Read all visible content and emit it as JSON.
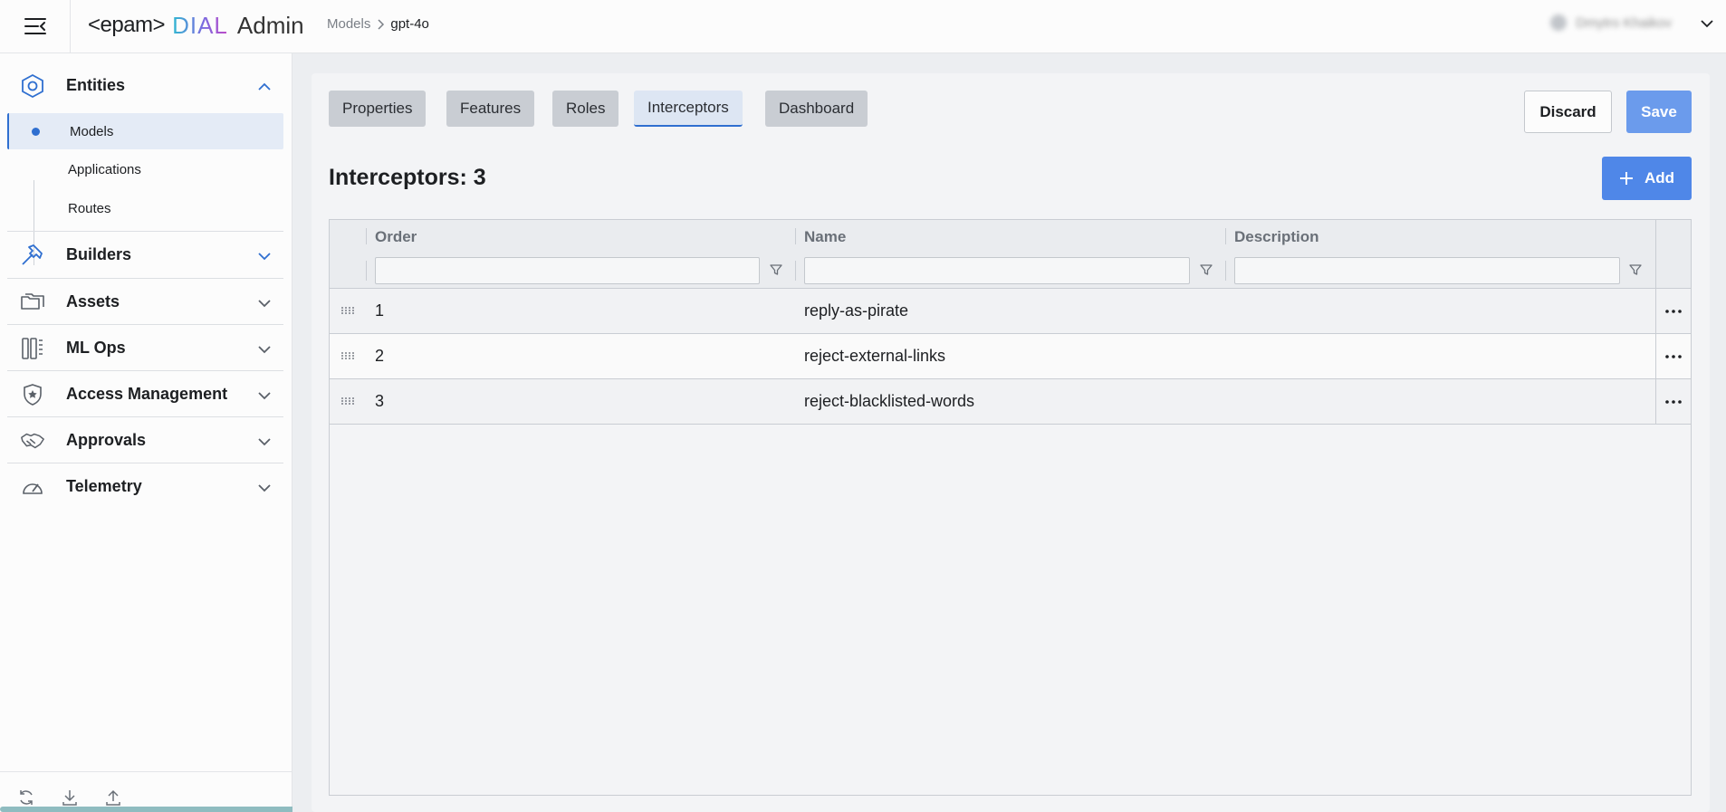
{
  "header": {
    "logo": {
      "epam": "<epam>",
      "dial": "DIAL",
      "admin": "Admin"
    },
    "breadcrumb": {
      "parent": "Models",
      "current": "gpt-4o"
    },
    "user": {
      "name": "Dmytro Khaikov"
    }
  },
  "sidebar": {
    "sections": [
      {
        "label": "Entities",
        "icon": "hexagon-icon",
        "expanded": true
      },
      {
        "label": "Builders",
        "icon": "hammer-icon",
        "expanded": false
      },
      {
        "label": "Assets",
        "icon": "folders-icon",
        "expanded": false
      },
      {
        "label": "ML Ops",
        "icon": "mlops-icon",
        "expanded": false
      },
      {
        "label": "Access Management",
        "icon": "shield-star-icon",
        "expanded": false
      },
      {
        "label": "Approvals",
        "icon": "handshake-icon",
        "expanded": false
      },
      {
        "label": "Telemetry",
        "icon": "gauge-icon",
        "expanded": false
      }
    ],
    "entities_items": [
      {
        "label": "Models",
        "active": true
      },
      {
        "label": "Applications",
        "active": false
      },
      {
        "label": "Routes",
        "active": false
      }
    ],
    "footer_icons": [
      "refresh-icon",
      "download-icon",
      "upload-icon"
    ]
  },
  "tabs": [
    {
      "label": "Properties",
      "active": false
    },
    {
      "label": "Features",
      "active": false
    },
    {
      "label": "Roles",
      "active": false
    },
    {
      "label": "Interceptors",
      "active": true
    },
    {
      "label": "Dashboard",
      "active": false
    }
  ],
  "actions": {
    "discard": "Discard",
    "save": "Save",
    "add": "Add"
  },
  "interceptors": {
    "title": "Interceptors: 3",
    "columns": {
      "order": "Order",
      "name": "Name",
      "description": "Description"
    },
    "filters": {
      "order": "",
      "name": "",
      "description": ""
    },
    "rows": [
      {
        "order": "1",
        "name": "reply-as-pirate",
        "description": ""
      },
      {
        "order": "2",
        "name": "reject-external-links",
        "description": ""
      },
      {
        "order": "3",
        "name": "reject-blacklisted-words",
        "description": ""
      }
    ]
  },
  "colors": {
    "accent": "#2f6fd0",
    "save_button": "#6b9bec",
    "add_button": "#4f87e8"
  }
}
